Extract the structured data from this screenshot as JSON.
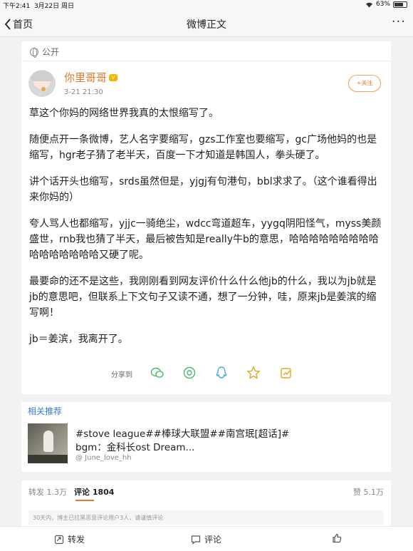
{
  "status_bar": {
    "time": "下午2:41",
    "date": "3月22日 周日",
    "battery": "63%"
  },
  "nav": {
    "back_label": "首页",
    "title": "微博正文",
    "more": "···"
  },
  "post": {
    "visibility": "公开",
    "author": "你里哥哥",
    "time": "3-21 21:30",
    "follow_label": "+关注",
    "paragraphs": [
      "草这个你妈的网络世界我真的太恨缩写了。",
      "随便点开一条微博，艺人名字要缩写，gzs工作室也要缩写，gc广场他妈的也是缩写，hgr老子猜了老半天，百度一下才知道是韩国人，拳头硬了。",
      "讲个话开头也缩写，srds虽然但是，yjgj有句港句，bbl求求了。（这个谁看得出来你妈的）",
      "夸人骂人也都缩写，yjjc一骑绝尘，wdcc弯道超车，yygq阴阳怪气，myss美颜盛世，rnb我也猜了半天，最后被告知是really牛b的意思，哈哈哈哈哈哈哈哈哈哈哈哈哈哈哈哈又硬了呢。",
      "最要命的还不是这些，我刚刚看到网友评价什么什么他jb的什么，我以为jb就是jb的意思吧，但联系上下文句子又读不通，想了一分钟，哇，原来jb是姜滨的缩写啊！",
      "jb＝姜滨，我离开了。"
    ],
    "share_label": "分享到"
  },
  "related": {
    "title": "相关推荐",
    "line1": "#stove league##棒球大联盟##南宫珉[超话]#",
    "line2": "bgm：金科长ost Dream...",
    "user": "@ June_love_hh"
  },
  "stats": {
    "repost": "转发 1.3万",
    "comment": "评论 1804",
    "like": "赞 5.1万",
    "notice": "30天内，博主已拉黑恶意评论用户3人，请谨慎评论"
  },
  "bottom_bar": {
    "repost": "转发",
    "comment": "评论",
    "like": ""
  },
  "colors": {
    "accent": "#e8782a",
    "link": "#3a7bd5",
    "share_green": "#4cb96a",
    "share_blue": "#3a9ad9",
    "share_gold": "#e0a820"
  }
}
